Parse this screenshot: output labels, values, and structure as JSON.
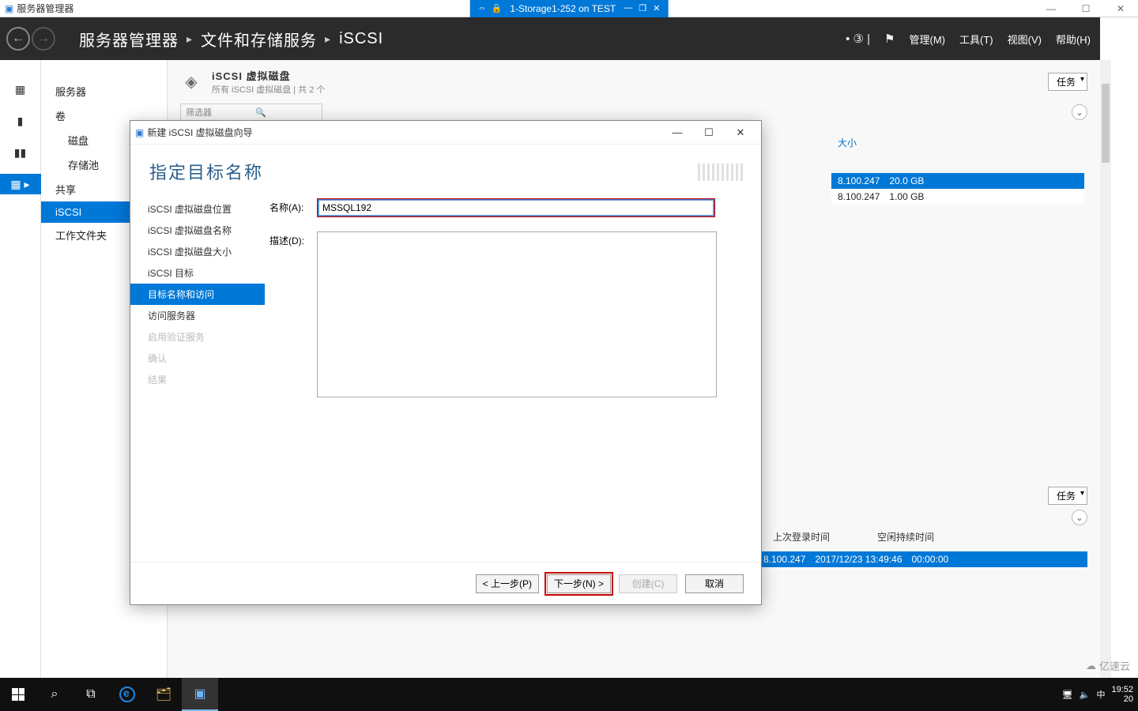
{
  "vm": {
    "app_title": "服务器管理器",
    "session_title": "1-Storage1-252 on TEST"
  },
  "outer_window": {
    "minimize": "—",
    "maximize": "☐",
    "close": "✕"
  },
  "header": {
    "breadcrumb": [
      "服务器管理器",
      "文件和存储服务",
      "iSCSI"
    ],
    "menu": {
      "manage": "管理(M)",
      "tools": "工具(T)",
      "view": "视图(V)",
      "help": "帮助(H)"
    }
  },
  "left_nav": {
    "items": [
      {
        "label": "服务器",
        "sub": false
      },
      {
        "label": "卷",
        "sub": false
      },
      {
        "label": "磁盘",
        "sub": true
      },
      {
        "label": "存储池",
        "sub": true
      },
      {
        "label": "共享",
        "sub": false
      },
      {
        "label": "iSCSI",
        "sub": false,
        "active": true
      },
      {
        "label": "工作文件夹",
        "sub": false
      }
    ]
  },
  "panel_top": {
    "title": "iSCSI 虚拟磁盘",
    "subtitle": "所有 iSCSI 虚拟磁盘 | 共 2 个",
    "tasks_label": "任务",
    "size_col": "大小",
    "rows": [
      {
        "ip_tail": "8.100.247",
        "size": "20.0 GB"
      },
      {
        "ip_tail": "8.100.247",
        "size": "1.00 GB"
      }
    ]
  },
  "panel_bottom": {
    "tasks_label": "任务",
    "cols": {
      "last_login": "上次登录时间",
      "idle": "空闲持续时间"
    },
    "row": {
      "ip_tail": "8.100.247",
      "login_time": "2017/12/23 13:49:46",
      "idle": "00:00:00"
    }
  },
  "wizard": {
    "window_title": "新建 iSCSI 虚拟磁盘向导",
    "heading": "指定目标名称",
    "steps": [
      {
        "label": "iSCSI 虚拟磁盘位置",
        "state": "done"
      },
      {
        "label": "iSCSI 虚拟磁盘名称",
        "state": "done"
      },
      {
        "label": "iSCSI 虚拟磁盘大小",
        "state": "done"
      },
      {
        "label": "iSCSI 目标",
        "state": "done"
      },
      {
        "label": "目标名称和访问",
        "state": "active"
      },
      {
        "label": "访问服务器",
        "state": "next"
      },
      {
        "label": "启用验证服务",
        "state": "disabled"
      },
      {
        "label": "确认",
        "state": "disabled"
      },
      {
        "label": "结果",
        "state": "disabled"
      }
    ],
    "form": {
      "name_label": "名称(A):",
      "name_value": "MSSQL192",
      "desc_label": "描述(D):",
      "desc_value": ""
    },
    "buttons": {
      "prev": "< 上一步(P)",
      "next": "下一步(N) >",
      "create": "创建(C)",
      "cancel": "取消"
    }
  },
  "taskbar": {
    "time": "19:52",
    "date_partial": "20",
    "ime": "中"
  },
  "watermark": "亿速云"
}
